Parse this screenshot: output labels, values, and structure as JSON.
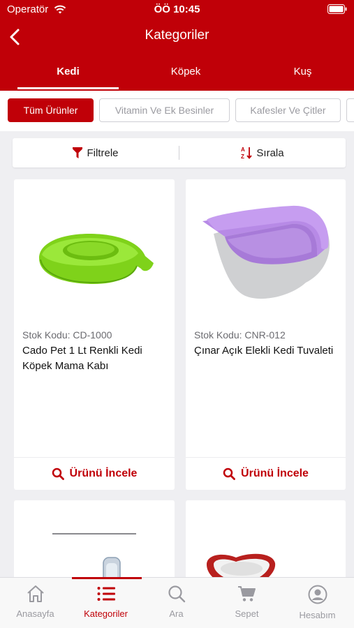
{
  "status": {
    "carrier": "Operatör",
    "time": "ÖÖ 10:45"
  },
  "header": {
    "title": "Kategoriler",
    "back_icon": "chevron-left-icon"
  },
  "tabs": [
    {
      "label": "Kedi",
      "active": true
    },
    {
      "label": "Köpek",
      "active": false
    },
    {
      "label": "Kuş",
      "active": false
    }
  ],
  "chips": [
    {
      "label": "Tüm Ürünler",
      "active": true
    },
    {
      "label": "Vitamin Ve Ek Besinler",
      "active": false
    },
    {
      "label": "Kafesler Ve Çitler",
      "active": false
    },
    {
      "label": "",
      "active": false
    }
  ],
  "toolbar": {
    "filter_label": "Filtrele",
    "sort_label": "Sırala",
    "filter_icon": "funnel-icon",
    "sort_icon": "sort-az-icon"
  },
  "products": [
    {
      "code": "Stok Kodu: CD-1000",
      "title": "Cado Pet 1 Lt Renkli Kedi Köpek Mama Kabı",
      "action": "Ürünü İncele"
    },
    {
      "code": "Stok Kodu: CNR-012",
      "title": "Çınar Açık Elekli Kedi Tuvaleti",
      "action": "Ürünü İncele"
    }
  ],
  "tabbar": [
    {
      "label": "Anasayfa",
      "icon": "home-icon",
      "active": false
    },
    {
      "label": "Kategoriler",
      "icon": "list-icon",
      "active": true
    },
    {
      "label": "Ara",
      "icon": "search-icon",
      "active": false
    },
    {
      "label": "Sepet",
      "icon": "cart-icon",
      "active": false
    },
    {
      "label": "Hesabım",
      "icon": "user-icon",
      "active": false
    }
  ],
  "colors": {
    "brand": "#c00008",
    "background": "#efeff2",
    "inactive": "#9a9aa0"
  }
}
